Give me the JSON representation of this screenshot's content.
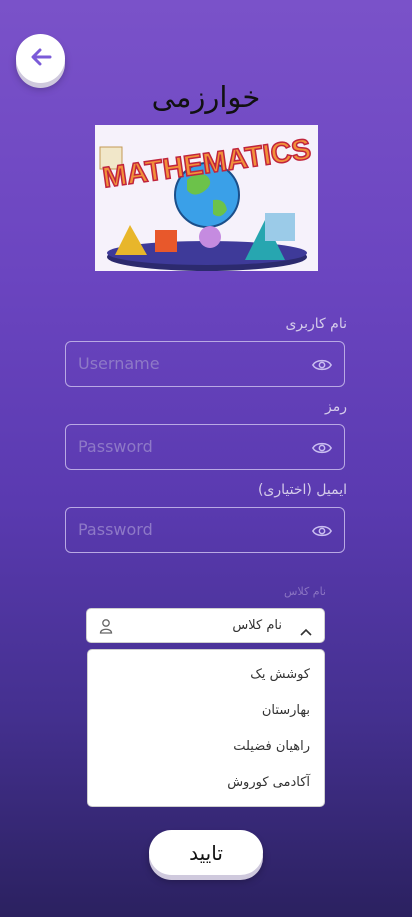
{
  "header": {
    "back_icon": "arrow-left-icon",
    "title": "خوارزمی"
  },
  "banner": {
    "text": "MATHEMATICS",
    "description_icon": "mathematics-banner"
  },
  "form": {
    "username_label": "نام کاربری",
    "username_placeholder": "Username",
    "password_label": "رمز",
    "password_placeholder": "Password",
    "email_label": "ایمیل (اختیاری)",
    "email_placeholder": "Password",
    "class_caption": "نام کلاس",
    "class_select_value": "نام کلاس",
    "class_options": [
      "کوشش یک",
      "بهارستان",
      "راهیان فضیلت",
      "آکادمی کوروش"
    ],
    "submit_label": "تایید"
  },
  "colors": {
    "accent": "#7b5bd8",
    "bg_top": "#7a52c9",
    "bg_bottom": "#2b2160"
  }
}
